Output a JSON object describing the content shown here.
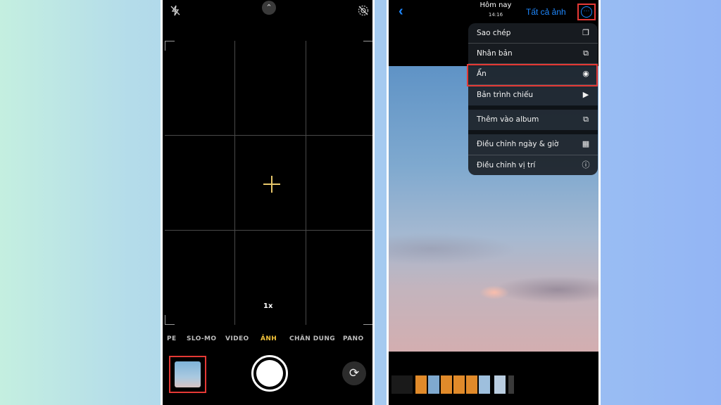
{
  "camera": {
    "top_icons": [
      "flash-off-icon",
      "chevron-up-icon",
      "live-photo-off-icon"
    ],
    "zoom": "1x",
    "modes": [
      "PE",
      "SLO-MO",
      "VIDEO",
      "ẢNH",
      "CHÂN DUNG",
      "PANO"
    ],
    "active_mode": "ẢNH",
    "chevron_glyph": "⌃",
    "flip_glyph": "⟳"
  },
  "photos": {
    "header": {
      "back_glyph": "‹",
      "title": "Hôm nay",
      "time": "14:16",
      "all_photos": "Tất cả ảnh",
      "more_glyph": "···"
    },
    "menu": [
      {
        "label": "Sao chép",
        "icon": "copy-icon",
        "glyph": "❐"
      },
      {
        "label": "Nhân bản",
        "icon": "duplicate-icon",
        "glyph": "⧉"
      },
      {
        "label": "Ẩn",
        "icon": "eye-icon",
        "glyph": "◉"
      },
      {
        "label": "Bản trình chiếu",
        "icon": "play-icon",
        "glyph": "▶"
      },
      {
        "label": "Thêm vào album",
        "icon": "add-album-icon",
        "glyph": "⧉"
      },
      {
        "label": "Điều chỉnh ngày & giờ",
        "icon": "calendar-icon",
        "glyph": "▦"
      },
      {
        "label": "Điều chỉnh vị trí",
        "icon": "info-icon",
        "glyph": "ⓘ"
      }
    ],
    "highlight_color": "#e53935",
    "accent_color": "#1e88ff"
  }
}
